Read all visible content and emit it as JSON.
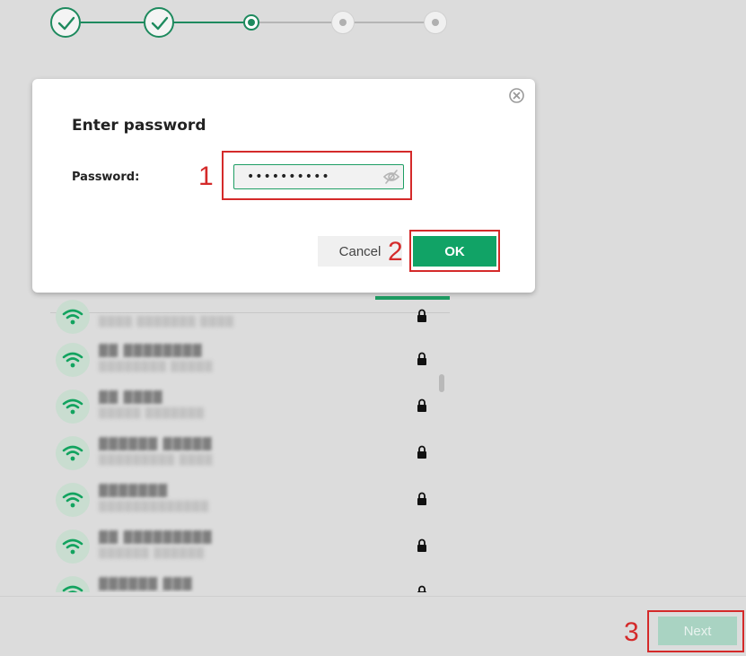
{
  "dialog": {
    "title": "Enter password",
    "password_label": "Password:",
    "password_value": "••••••••••",
    "cancel_label": "Cancel",
    "ok_label": "OK"
  },
  "footer": {
    "next_label": "Next"
  },
  "stepper": {
    "steps": [
      {
        "state": "completed"
      },
      {
        "state": "completed"
      },
      {
        "state": "current"
      },
      {
        "state": "upcoming"
      },
      {
        "state": "upcoming"
      }
    ]
  },
  "networks": [
    {
      "ssid": "▓▓▓▓ ▓▓▓▓▓▓",
      "detail": "▒▒▒▒ ▒▒▒▒▒▒▒ ▒▒▒▒",
      "secured": true
    },
    {
      "ssid": "▓▓ ▓▓▓▓▓▓▓▓",
      "detail": "▒▒▒▒▒▒▒▒ ▒▒▒▒▒",
      "secured": true
    },
    {
      "ssid": "▓▓ ▓▓▓▓",
      "detail": "▒▒▒▒▒ ▒▒▒▒▒▒▒",
      "secured": true
    },
    {
      "ssid": "▓▓▓▓▓▓ ▓▓▓▓▓",
      "detail": "▒▒▒▒▒▒▒▒▒ ▒▒▒▒",
      "secured": true
    },
    {
      "ssid": "▓▓▓▓▓▓▓",
      "detail": "▒▒▒▒▒▒▒▒▒▒▒▒▒",
      "secured": true
    },
    {
      "ssid": "▓▓ ▓▓▓▓▓▓▓▓▓",
      "detail": "▒▒▒▒▒▒ ▒▒▒▒▒▒",
      "secured": true
    },
    {
      "ssid": "▓▓▓▓▓▓ ▓▓▓",
      "detail": "▒▒▒▒▒▒▒▒",
      "secured": true
    }
  ],
  "annotations": {
    "step1": "1",
    "step2": "2",
    "step3": "3"
  },
  "colors": {
    "accent": "#11a366",
    "step_line": "#1e8a5e",
    "disabled_button": "#a9d3c2",
    "annotation": "#d42a2a",
    "background": "#dcdcdc"
  },
  "icons": {
    "close": "close-circle-icon",
    "password_toggle": "eye-slash-icon",
    "step_done": "checkmark-icon",
    "network": "wifi-icon",
    "secured": "lock-icon"
  }
}
